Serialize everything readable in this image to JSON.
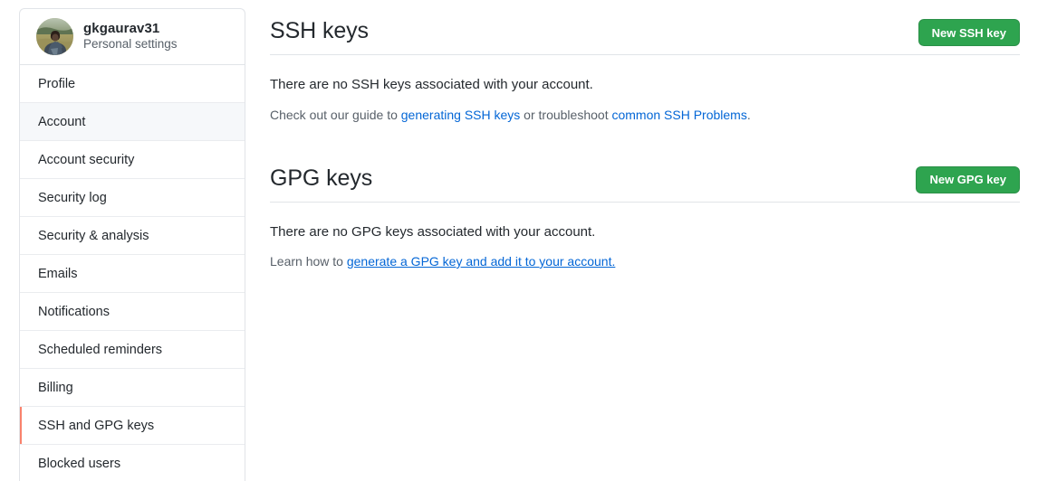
{
  "sidebar": {
    "profile": {
      "username": "gkgaurav31",
      "subtitle": "Personal settings",
      "avatar_icon": "user-photo-avatar"
    },
    "items": [
      {
        "label": "Profile",
        "state": "default"
      },
      {
        "label": "Account",
        "state": "hovered"
      },
      {
        "label": "Account security",
        "state": "default"
      },
      {
        "label": "Security log",
        "state": "default"
      },
      {
        "label": "Security & analysis",
        "state": "default"
      },
      {
        "label": "Emails",
        "state": "default"
      },
      {
        "label": "Notifications",
        "state": "default"
      },
      {
        "label": "Scheduled reminders",
        "state": "default"
      },
      {
        "label": "Billing",
        "state": "default"
      },
      {
        "label": "SSH and GPG keys",
        "state": "active"
      },
      {
        "label": "Blocked users",
        "state": "default"
      }
    ]
  },
  "main": {
    "ssh": {
      "title": "SSH keys",
      "button_label": "New SSH key",
      "empty_message": "There are no SSH keys associated with your account.",
      "help_prefix": "Check out our guide to ",
      "help_link_1": "generating SSH keys",
      "help_middle": " or troubleshoot ",
      "help_link_2": "common SSH Problems",
      "help_suffix": "."
    },
    "gpg": {
      "title": "GPG keys",
      "button_label": "New GPG key",
      "empty_message": "There are no GPG keys associated with your account.",
      "help_prefix": "Learn how to ",
      "help_link_1": "generate a GPG key and add it to your account.",
      "help_suffix": ""
    }
  },
  "colors": {
    "accent_green": "#2ea44f",
    "link_blue": "#0366d6",
    "active_indicator": "#f9826c",
    "text_primary": "#24292e",
    "text_muted": "#586069",
    "border": "#e1e4e8",
    "hover_bg": "#f6f8fa"
  }
}
